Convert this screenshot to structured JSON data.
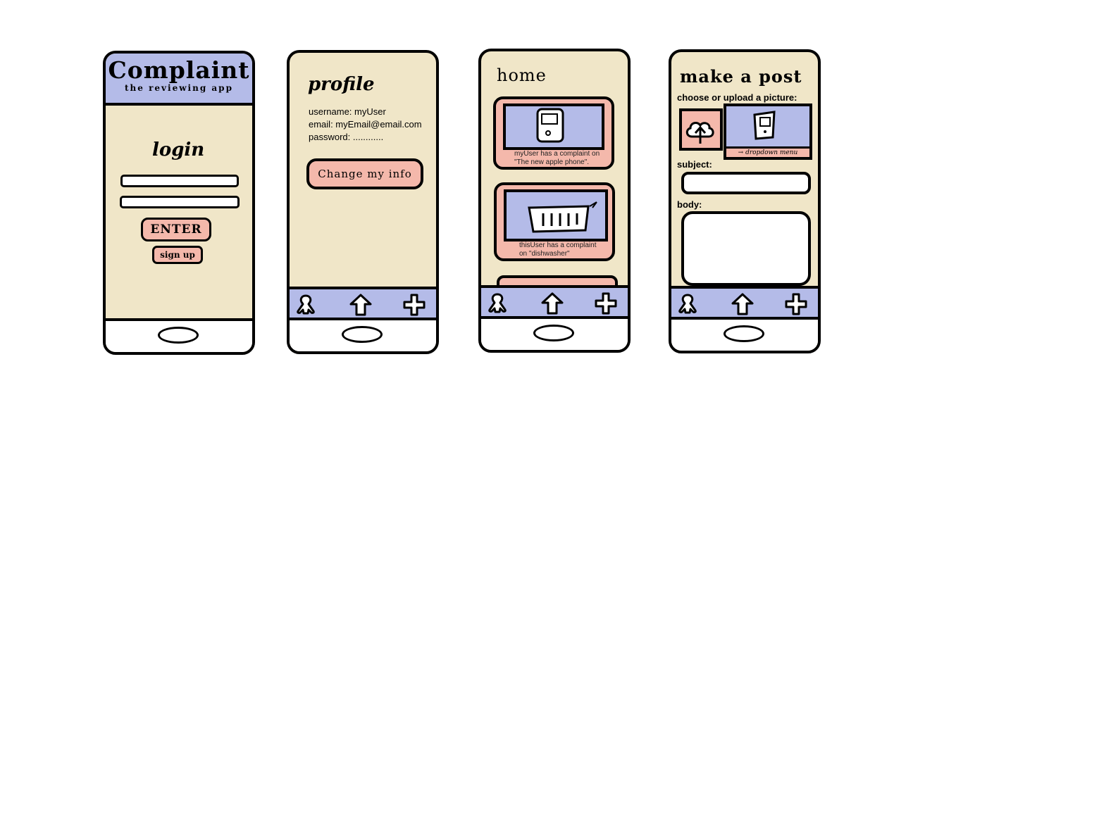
{
  "colors": {
    "cream": "#f0e6c8",
    "lavender": "#b4bbe8",
    "salmon": "#f4b8ab",
    "outline": "#000000"
  },
  "login": {
    "app_title": "Complaint",
    "app_subtitle": "the reviewing app",
    "login_label": "login",
    "enter_label": "ENTER",
    "signup_label": "sign up"
  },
  "profile": {
    "title": "profile",
    "username_line": "username: myUser",
    "email_line": "email: myEmail@email.com",
    "password_line": "password: ............",
    "change_label": "Change my info"
  },
  "home": {
    "title": "home",
    "posts": [
      {
        "text_line1": "myUser has a complaint on",
        "text_line2": "\"The new apple phone\".",
        "image_icon": "phone-sketch-icon"
      },
      {
        "text_line1": "thisUser has a complaint",
        "text_line2": "on \"dishwasher\"",
        "image_icon": "dishwasher-sketch-icon"
      }
    ]
  },
  "post": {
    "title": "make a post",
    "picture_label": "choose or upload a picture:",
    "dropdown_label": "→ dropdown menu",
    "subject_label": "subject:",
    "body_label": "body:"
  },
  "nav": {
    "icons": [
      "person-icon",
      "home-arrow-icon",
      "plus-icon"
    ]
  }
}
